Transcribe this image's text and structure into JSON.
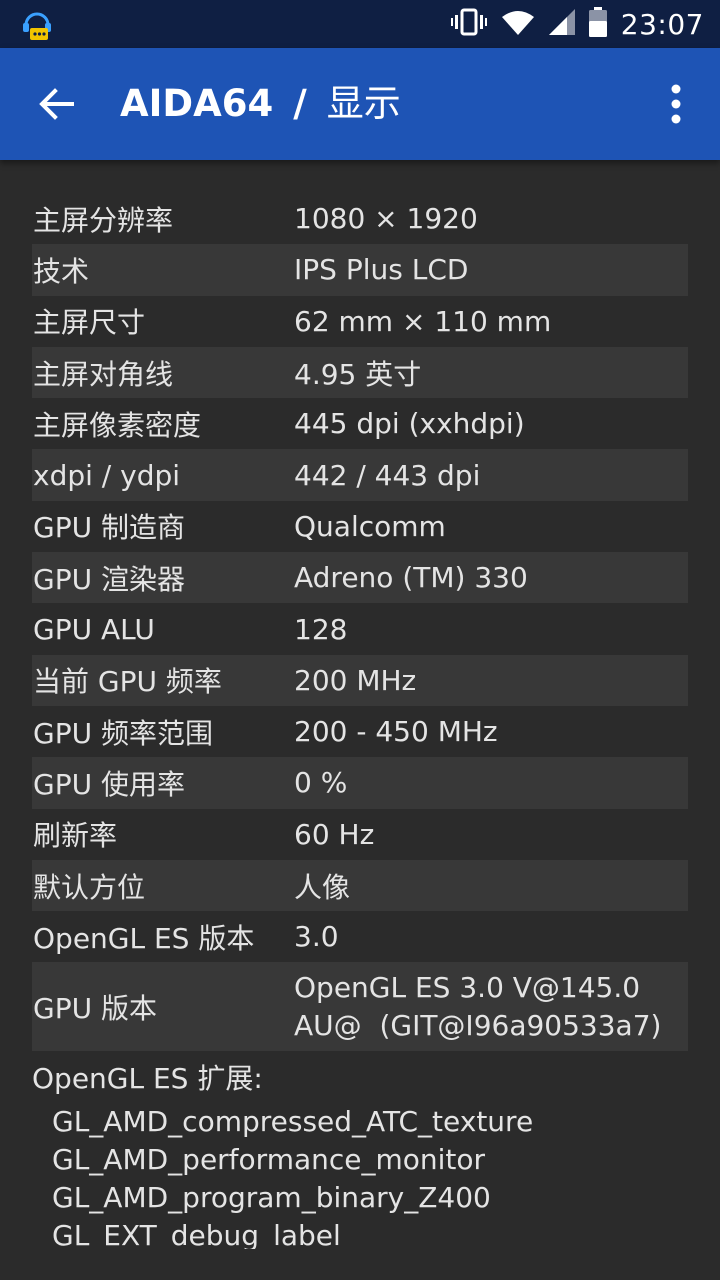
{
  "status_bar": {
    "time": "23:07",
    "icons": [
      "chat-bubble-notification-icon",
      "vibrate-icon",
      "wifi-icon",
      "cell-signal-icon",
      "battery-icon"
    ]
  },
  "app_bar": {
    "app_name": "AIDA64",
    "separator": "/",
    "section": "显示",
    "back_icon": "arrow-back-icon",
    "menu_icon": "more-vert-icon"
  },
  "colors": {
    "app_bar": "#1e54b5",
    "status_bar": "#0f1f43",
    "background": "#2b2b2b",
    "row_alt": "#383838",
    "text": "#e4e4e4"
  },
  "rows": [
    {
      "label": "主屏分辨率",
      "value": "1080 × 1920"
    },
    {
      "label": "技术",
      "value": "IPS Plus LCD"
    },
    {
      "label": "主屏尺寸",
      "value": "62 mm × 110 mm"
    },
    {
      "label": "主屏对角线",
      "value": "4.95 英寸"
    },
    {
      "label": "主屏像素密度",
      "value": "445 dpi (xxhdpi)"
    },
    {
      "label": "xdpi / ydpi",
      "value": "442 / 443 dpi"
    },
    {
      "label": "GPU 制造商",
      "value": "Qualcomm"
    },
    {
      "label": "GPU 渲染器",
      "value": "Adreno (TM) 330"
    },
    {
      "label": "GPU ALU",
      "value": "128"
    },
    {
      "label": "当前 GPU 频率",
      "value": "200 MHz"
    },
    {
      "label": "GPU 频率范围",
      "value": "200 - 450 MHz"
    },
    {
      "label": "GPU 使用率",
      "value": "0 %"
    },
    {
      "label": "刷新率",
      "value": "60 Hz"
    },
    {
      "label": "默认方位",
      "value": "人像"
    },
    {
      "label": "OpenGL ES 版本",
      "value": "3.0"
    }
  ],
  "gpu_version": {
    "label": "GPU 版本",
    "value_line1": "OpenGL ES 3.0 V@145.0",
    "value_line2": "AU@  (GIT@I96a90533a7)"
  },
  "extensions": {
    "header": "OpenGL ES 扩展:",
    "items": [
      "GL_AMD_compressed_ATC_texture",
      "GL_AMD_performance_monitor",
      "GL_AMD_program_binary_Z400",
      "GL_EXT_debug_label"
    ]
  }
}
